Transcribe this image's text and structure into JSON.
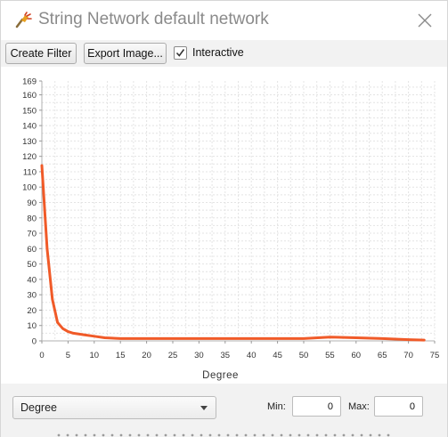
{
  "window": {
    "title": "String Network default network"
  },
  "toolbar": {
    "create_filter_label": "Create Filter",
    "export_image_label": "Export Image...",
    "interactive_label": "Interactive",
    "interactive_checked": true
  },
  "chart_data": {
    "type": "line",
    "xlabel": "Degree",
    "ylabel": "",
    "xlim": [
      0,
      75
    ],
    "ylim": [
      0,
      169
    ],
    "x_ticks": [
      0,
      5,
      10,
      15,
      20,
      25,
      30,
      35,
      40,
      45,
      50,
      55,
      60,
      65,
      70,
      75
    ],
    "y_ticks": [
      0,
      10,
      20,
      30,
      40,
      50,
      60,
      70,
      80,
      90,
      100,
      110,
      120,
      130,
      140,
      150,
      160,
      169
    ],
    "grid": true,
    "line_color": "#f05a28",
    "x": [
      0,
      1,
      2,
      3,
      4,
      5,
      6,
      8,
      10,
      12,
      15,
      20,
      25,
      30,
      35,
      40,
      45,
      50,
      55,
      60,
      65,
      70,
      73
    ],
    "values": [
      114,
      60,
      27,
      12,
      8,
      6,
      5,
      4,
      3,
      2,
      1.5,
      1.5,
      1.5,
      1.5,
      1.5,
      1.5,
      1.5,
      1.5,
      2.5,
      2,
      1.5,
      0.8,
      0.5
    ]
  },
  "bottom": {
    "selected_attribute": "Degree",
    "min_label": "Min:",
    "min_value": "0",
    "max_label": "Max:",
    "max_value": "0"
  }
}
